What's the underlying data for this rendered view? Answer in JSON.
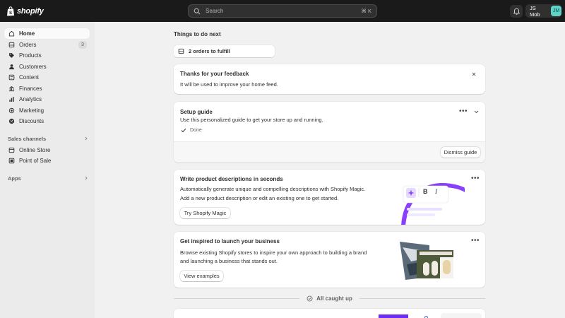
{
  "topbar": {
    "logo_text": "shopify",
    "search_placeholder": "Search",
    "search_shortcut": "⌘ K",
    "account_name": "JS Mob",
    "avatar_initials": "JM"
  },
  "sidebar": {
    "items": [
      {
        "label": "Home",
        "icon": "home-icon"
      },
      {
        "label": "Orders",
        "icon": "orders-icon",
        "badge": "3"
      },
      {
        "label": "Products",
        "icon": "tag-icon"
      },
      {
        "label": "Customers",
        "icon": "person-icon"
      },
      {
        "label": "Content",
        "icon": "content-icon"
      },
      {
        "label": "Finances",
        "icon": "bank-icon"
      },
      {
        "label": "Analytics",
        "icon": "chart-icon"
      },
      {
        "label": "Marketing",
        "icon": "target-icon"
      },
      {
        "label": "Discounts",
        "icon": "discount-icon"
      }
    ],
    "sales_channels_label": "Sales channels",
    "channels": [
      {
        "label": "Online Store",
        "icon": "store-icon"
      },
      {
        "label": "Point of Sale",
        "icon": "pos-icon"
      }
    ],
    "apps_label": "Apps"
  },
  "main": {
    "title": "Things to do next",
    "fulfill_chip": "2 orders to fulfill",
    "feedback": {
      "title": "Thanks for your feedback",
      "text": "It will be used to improve your home feed."
    },
    "setup": {
      "title": "Setup guide",
      "text": "Use this personalized guide to get your store up and running.",
      "done_label": "Done",
      "dismiss_label": "Dismiss guide"
    },
    "magic": {
      "title": "Write product descriptions in seconds",
      "line1": "Automatically generate unique and compelling descriptions with Shopify Magic.",
      "line2": "Add a new product description or edit an existing one to get started.",
      "button": "Try Shopify Magic",
      "bold_glyph": "B",
      "italic_glyph": "I"
    },
    "inspire": {
      "title": "Get inspired to launch your business",
      "line1": "Browse existing Shopify stores to inspire your own approach to building a brand",
      "line2": "and launching a business that stands out.",
      "button": "View examples"
    },
    "caught_up": "All caught up"
  },
  "colors": {
    "topbar": "#1a1a1a",
    "sidebar": "#ebebeb",
    "page": "#f1f1f1",
    "magic_purple": "#8a3ffc",
    "avatar": "#5fd3c6"
  }
}
